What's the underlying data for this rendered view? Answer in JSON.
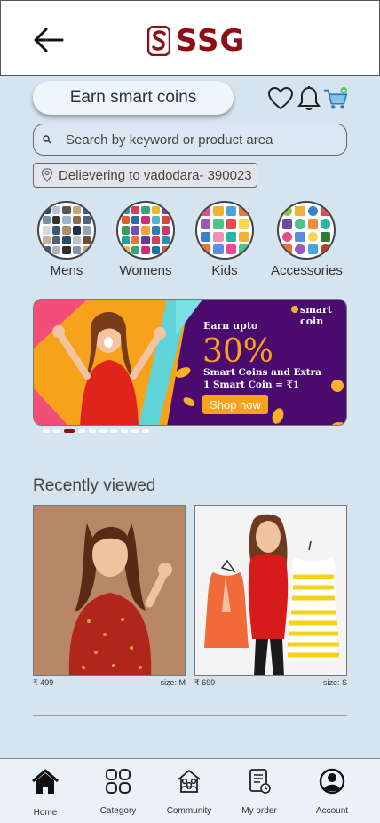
{
  "header": {
    "logo_text": "SSG",
    "back_icon": "arrow-left-icon"
  },
  "actions": {
    "earn_label": "Earn smart coins",
    "icons": [
      "heart-icon",
      "bell-icon",
      "cart-icon"
    ]
  },
  "search": {
    "placeholder": "Search by keyword or product area"
  },
  "delivery": {
    "text": "Delievering to vadodara- 390023"
  },
  "categories": [
    {
      "label": "Mens"
    },
    {
      "label": "Womens"
    },
    {
      "label": "Kids"
    },
    {
      "label": "Accessories"
    }
  ],
  "banner": {
    "brand_top": "smart",
    "brand_bottom": "coin",
    "earn_upto": "Earn upto",
    "percent": "30%",
    "line1": "Smart Coins and Extra",
    "line2": "1 Smart Coin = ₹1",
    "cta": "Shop now",
    "carousel_count": 10,
    "carousel_active": 3
  },
  "recent": {
    "title": "Recently viewed",
    "items": [
      {
        "price": "₹ 499",
        "size": "size: M"
      },
      {
        "price": "₹ 699",
        "size": "size: S"
      }
    ]
  },
  "nav": [
    {
      "label": "Home",
      "icon": "home-icon"
    },
    {
      "label": "Category",
      "icon": "category-icon"
    },
    {
      "label": "Community",
      "icon": "community-icon"
    },
    {
      "label": "My order",
      "icon": "order-icon"
    },
    {
      "label": "Account",
      "icon": "account-icon"
    }
  ],
  "colors": {
    "brand": "#8b0f14",
    "background": "#d6e4ef",
    "banner_purple": "#4a0a6e",
    "banner_orange": "#f7a21b"
  }
}
